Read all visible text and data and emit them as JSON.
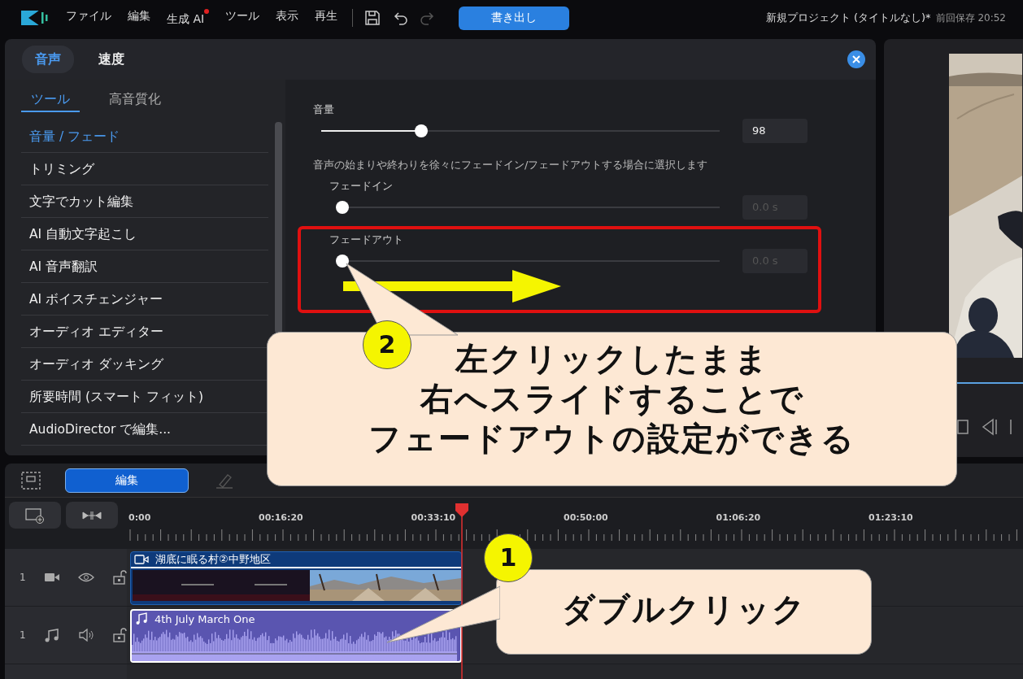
{
  "menu": [
    {
      "label": "ファイル",
      "badge": false
    },
    {
      "label": "編集",
      "badge": false
    },
    {
      "label": "生成 AI",
      "badge": true
    },
    {
      "label": "ツール",
      "badge": false
    },
    {
      "label": "表示",
      "badge": false
    },
    {
      "label": "再生",
      "badge": false
    }
  ],
  "export_button": "書き出し",
  "project": {
    "title": "新規プロジェクト (タイトルなし)*",
    "saved": "前回保存 20:52"
  },
  "panel": {
    "tabs": [
      {
        "label": "音声",
        "selected": true
      },
      {
        "label": "速度",
        "selected": false
      }
    ],
    "subtabs": [
      {
        "label": "ツール",
        "selected": true
      },
      {
        "label": "高音質化",
        "selected": false
      }
    ],
    "items": [
      {
        "label": "音量 / フェード",
        "selected": true
      },
      {
        "label": "トリミング",
        "selected": false
      },
      {
        "label": "文字でカット編集",
        "selected": false
      },
      {
        "label": "AI 自動文字起こし",
        "selected": false
      },
      {
        "label": "AI 音声翻訳",
        "selected": false
      },
      {
        "label": "AI ボイスチェンジャー",
        "selected": false
      },
      {
        "label": "オーディオ エディター",
        "selected": false
      },
      {
        "label": "オーディオ ダッキング",
        "selected": false
      },
      {
        "label": "所要時間 (スマート フィット)",
        "selected": false
      },
      {
        "label": "AudioDirector で編集...",
        "selected": false
      }
    ],
    "volume": {
      "label": "音量",
      "level": 0.25,
      "value": "98",
      "disabled": false
    },
    "description": "音声の始まりや終わりを徐々にフェードイン/フェードアウトする場合に選択します",
    "fades": [
      {
        "label": "フェードイン",
        "level": 0,
        "value": "0.0 s",
        "disabled": true
      },
      {
        "label": "フェードアウト",
        "level": 0,
        "value": "0.0 s",
        "disabled": true
      }
    ]
  },
  "timeline": {
    "edit_button": "編集",
    "ruler": [
      "0:00",
      "00:16:20",
      "00:33:10",
      "00:50:00",
      "01:06:20",
      "01:23:10"
    ],
    "tracks": [
      {
        "kind": "video",
        "number": "1",
        "clip": "湖底に眠る村②中野地区"
      },
      {
        "kind": "audio",
        "number": "1",
        "clip": "4th July March One"
      }
    ]
  },
  "callouts": [
    {
      "number": "2",
      "lines": [
        "左クリックしたまま",
        "右へスライドすることで",
        "フェードアウトの設定ができる"
      ]
    },
    {
      "number": "1",
      "lines": [
        "ダブルクリック"
      ]
    }
  ]
}
